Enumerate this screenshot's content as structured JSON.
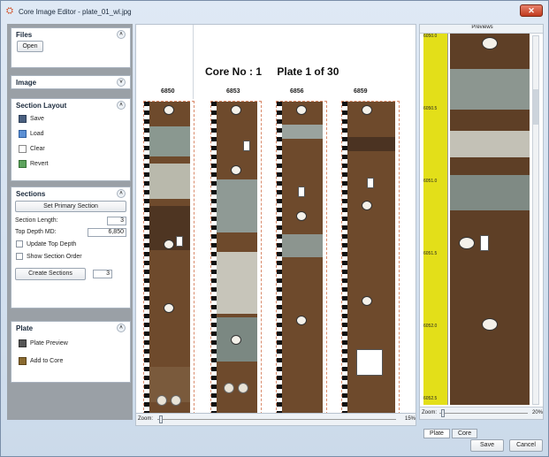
{
  "window": {
    "title": "Core Image Editor - plate_01_wl.jpg",
    "close": "✕"
  },
  "sidebar": {
    "files": {
      "title": "Files",
      "open": "Open"
    },
    "image": {
      "title": "Image"
    },
    "section_layout": {
      "title": "Section Layout",
      "items": [
        "Save",
        "Load",
        "Clear",
        "Revert"
      ]
    },
    "sections": {
      "title": "Sections",
      "set_primary": "Set Primary Section",
      "section_length_label": "Section Length:",
      "section_length_value": "3",
      "top_depth_label": "Top Depth MD:",
      "top_depth_value": "6,850",
      "update_top_depth": "Update Top Depth",
      "show_section_order": "Show Section Order",
      "create_sections": "Create Sections",
      "create_count": "3"
    },
    "plate": {
      "title": "Plate",
      "items": [
        "Plate Preview",
        "Add to Core"
      ]
    }
  },
  "main": {
    "core_no": "Core No : 1",
    "plate_of": "Plate 1 of 30",
    "depths": [
      "6850",
      "6853",
      "6856",
      "6859"
    ],
    "zoom_label": "Zoom:",
    "zoom_value": "15%"
  },
  "preview": {
    "title": "Previews",
    "ticks": [
      "6050.0",
      "6050.5",
      "6051.0",
      "6051.5",
      "6052.0",
      "6052.5"
    ],
    "zoom_label": "Zoom:",
    "zoom_value": "20%",
    "tabs": [
      "Plate",
      "Core"
    ]
  },
  "buttons": {
    "save": "Save",
    "cancel": "Cancel"
  },
  "colors": {
    "ruler_yellow": "#e3df19",
    "core_brown": "#6e4a2c",
    "accent_red": "#d24a20"
  }
}
